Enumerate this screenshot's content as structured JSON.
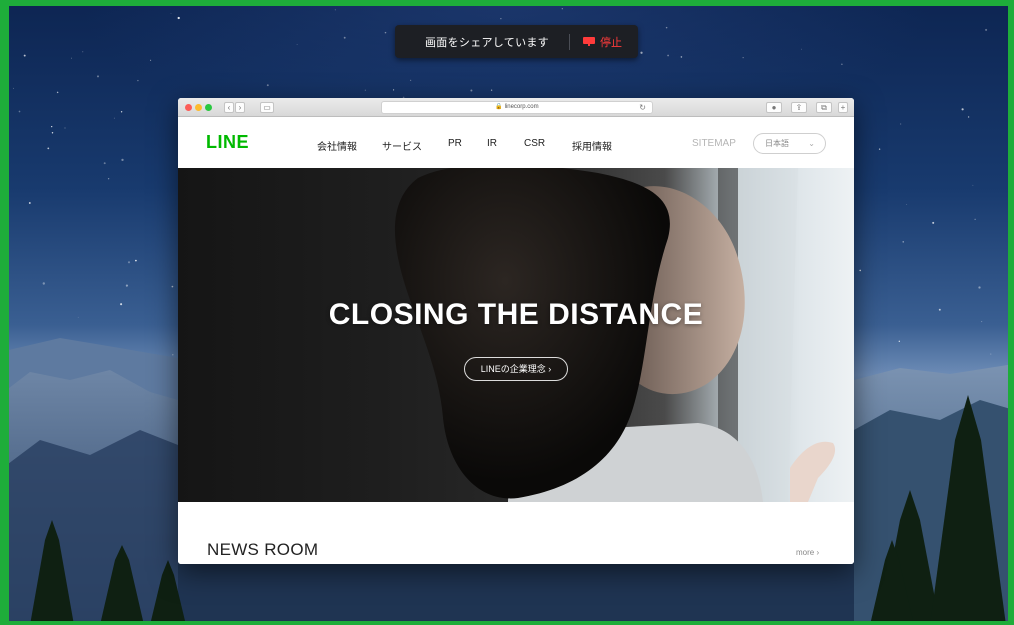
{
  "share_bar": {
    "status_text": "画面をシェアしています",
    "stop_label": "停止"
  },
  "browser": {
    "url": "linecorp.com",
    "url_lock_icon": "lock-icon",
    "reload_icon": "reload-icon"
  },
  "site": {
    "logo": "LINE",
    "nav": [
      "会社情報",
      "サービス",
      "PR",
      "IR",
      "CSR",
      "採用情報"
    ],
    "sitemap": "SITEMAP",
    "language": "日本語",
    "hero_title": "CLOSING THE DISTANCE",
    "hero_button": "LINEの企業理念 ›",
    "news_title": "NEWS ROOM",
    "news_more": "more ›"
  },
  "colors": {
    "share_border": "#1ead3a",
    "line_brand": "#00b900",
    "stop_red": "#ff3b3b"
  }
}
